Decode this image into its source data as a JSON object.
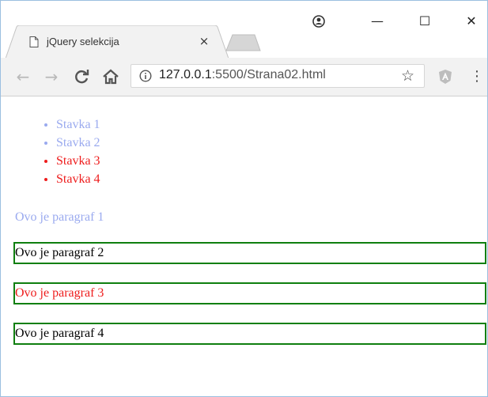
{
  "browser": {
    "tab_title": "jQuery selekcija",
    "tab_close": "×",
    "url_host": "127.0.0.1",
    "url_rest": ":5500/Strana02.html",
    "window_controls": {
      "minimize": "—",
      "maximize": "☐",
      "close": "✕"
    },
    "icons": [
      "page-icon",
      "profile-icon",
      "back-icon",
      "forward-icon",
      "reload-icon",
      "home-icon",
      "info-icon",
      "star-icon",
      "angular-extension-icon",
      "menu-icon"
    ]
  },
  "page": {
    "list_items": [
      {
        "label": "Stavka 1",
        "color": "#9aaaef"
      },
      {
        "label": "Stavka 2",
        "color": "#9aaaef"
      },
      {
        "label": "Stavka 3",
        "color": "#ee1c1c"
      },
      {
        "label": "Stavka 4",
        "color": "#ee1c1c"
      }
    ],
    "paragraphs": [
      {
        "text": "Ovo je paragraf 1",
        "color": "#9aaaef",
        "bordered": false
      },
      {
        "text": "Ovo je paragraf 2",
        "color": "#000000",
        "bordered": true
      },
      {
        "text": "Ovo je paragraf 3",
        "color": "#ee1c1c",
        "bordered": true
      },
      {
        "text": "Ovo je paragraf 4",
        "color": "#000000",
        "bordered": true
      }
    ],
    "border_color": "#0f7f0f"
  }
}
